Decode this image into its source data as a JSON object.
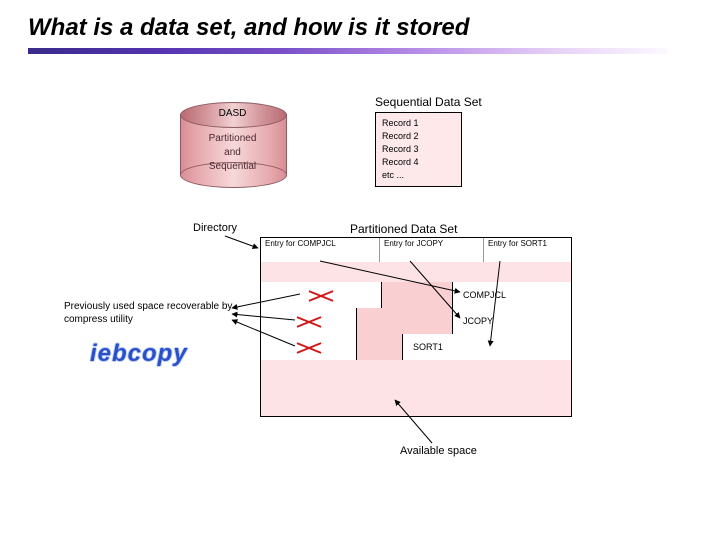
{
  "title": "What is a data set, and how is it stored",
  "dasd": {
    "top_label": "DASD",
    "sub_label_1": "Partitioned",
    "sub_label_2": "and",
    "sub_label_3": "Sequential"
  },
  "sequential": {
    "title": "Sequential Data Set",
    "records": [
      "Record 1",
      "Record 2",
      "Record 3",
      "Record 4",
      "etc ..."
    ]
  },
  "pds": {
    "title": "Partitioned Data Set",
    "directory_label": "Directory",
    "dir_entries": [
      "Entry for COMPJCL",
      "Entry for JCOPY",
      "Entry for SORT1"
    ],
    "members": [
      "COMPJCL",
      "JCOPY",
      "SORT1"
    ]
  },
  "annotations": {
    "previously_used": "Previously used space recoverable by compress utility",
    "iebcopy": "iebcopy",
    "available_space": "Available space"
  }
}
